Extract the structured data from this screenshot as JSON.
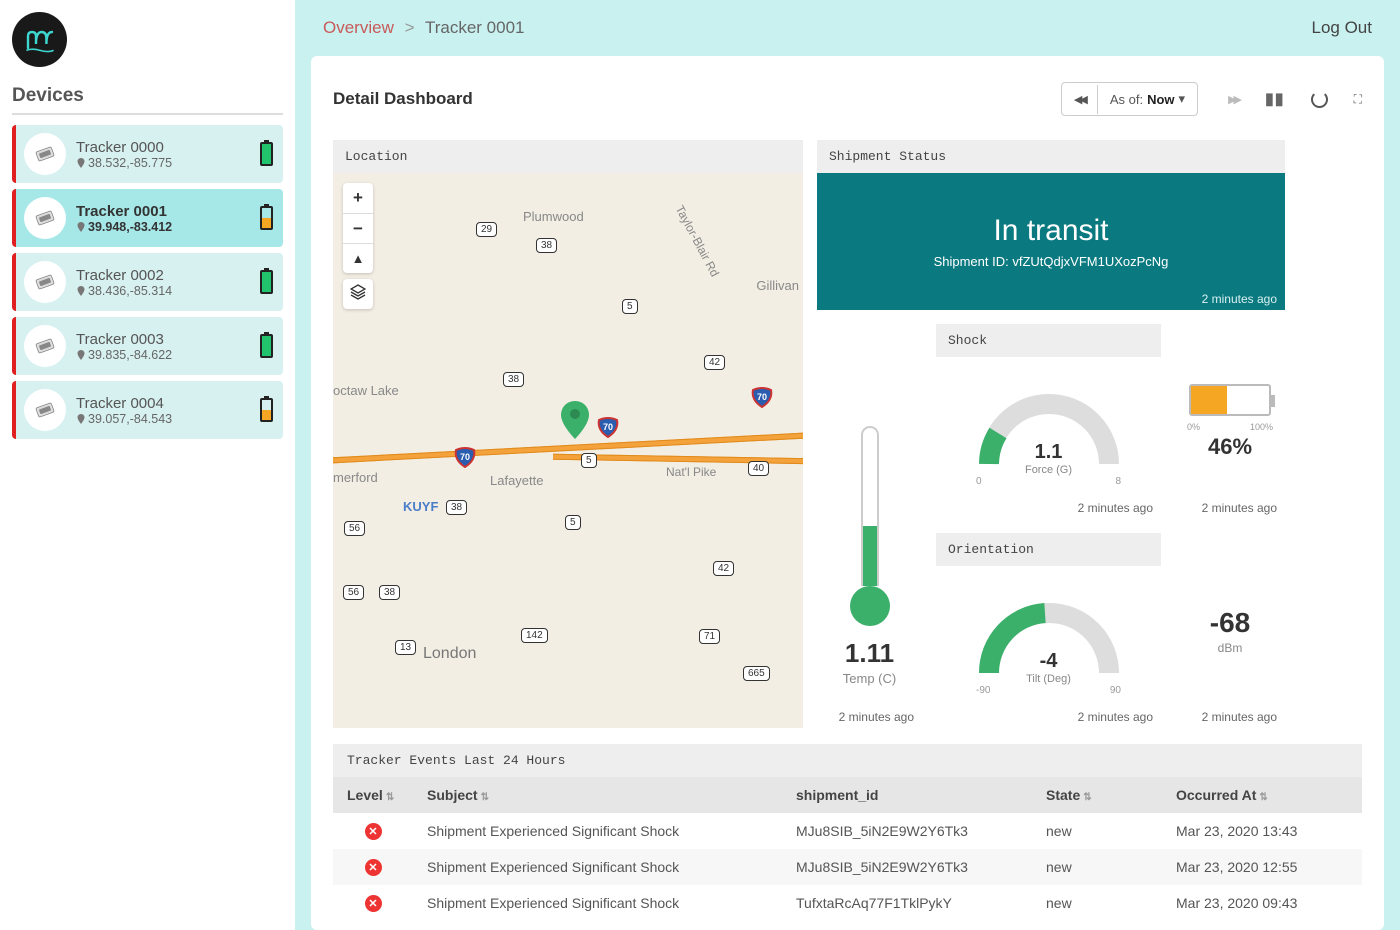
{
  "sidebar": {
    "title": "Devices",
    "items": [
      {
        "name": "Tracker 0000",
        "loc": "38.532,-85.775",
        "battery": "green",
        "active": false
      },
      {
        "name": "Tracker 0001",
        "loc": "39.948,-83.412",
        "battery": "orange",
        "active": true
      },
      {
        "name": "Tracker 0002",
        "loc": "38.436,-85.314",
        "battery": "green",
        "active": false
      },
      {
        "name": "Tracker 0003",
        "loc": "39.835,-84.622",
        "battery": "green",
        "active": false
      },
      {
        "name": "Tracker 0004",
        "loc": "39.057,-84.543",
        "battery": "orange",
        "active": false
      }
    ]
  },
  "topbar": {
    "crumb_overview": "Overview",
    "crumb_sep": ">",
    "crumb_current": "Tracker 0001",
    "logout": "Log Out"
  },
  "dash": {
    "title": "Detail Dashboard",
    "asof_label": "As of:",
    "asof_value": "Now",
    "prev_icon": "◀◀",
    "next_icon": "▶▶",
    "caret": "▾"
  },
  "cards": {
    "location": {
      "header": "Location"
    },
    "status": {
      "header": "Shipment Status",
      "value": "In transit",
      "sub_label": "Shipment ID:",
      "shipment_id": "vfZUtQdjxVFM1UXozPcNg",
      "ts": "2 minutes ago"
    },
    "temp": {
      "value": "1.11",
      "unit": "Temp (C)",
      "ts": "2 minutes ago"
    },
    "shock": {
      "header": "Shock",
      "value": "1.1",
      "unit": "Force (G)",
      "min": "0",
      "max": "8",
      "ts": "2 minutes ago"
    },
    "orient": {
      "header": "Orientation",
      "value": "-4",
      "unit": "Tilt (Deg)",
      "min": "-90",
      "max": "90",
      "ts": "2 minutes ago"
    },
    "batt": {
      "pct": "46%",
      "min": "0%",
      "max": "100%",
      "ts": "2 minutes ago",
      "fill_pct": 46
    },
    "signal": {
      "value": "-68",
      "unit": "dBm",
      "ts": "2 minutes ago"
    }
  },
  "map": {
    "towns": {
      "plumwood": "Plumwood",
      "gillivan": "Gillivan",
      "lafayette": "Lafayette",
      "london": "London",
      "choctaw": "octaw Lake",
      "merford": "merford",
      "kuyf": "KUYF",
      "natl_pike": "Nat'l Pike",
      "taylor_blair": "Taylor-Blair Rd"
    },
    "shields": {
      "r29": "29",
      "r38a": "38",
      "r38b": "38",
      "r38c": "38",
      "r38d": "38",
      "r5a": "5",
      "r5b": "5",
      "r5c": "5",
      "r42a": "42",
      "r42b": "42",
      "r56a": "56",
      "r56b": "56",
      "r40": "40",
      "r71": "71",
      "r142": "142",
      "r13": "13",
      "r665": "665",
      "i70a": "70",
      "i70b": "70",
      "i70c": "70"
    }
  },
  "events": {
    "header": "Tracker Events Last 24 Hours",
    "columns": {
      "level": "Level",
      "subject": "Subject",
      "shipment": "shipment_id",
      "state": "State",
      "occurred": "Occurred At"
    },
    "rows": [
      {
        "subject": "Shipment Experienced Significant Shock",
        "shipment_id": "MJu8SIB_5iN2E9W2Y6Tk3",
        "state": "new",
        "occurred": "Mar 23, 2020 13:43"
      },
      {
        "subject": "Shipment Experienced Significant Shock",
        "shipment_id": "MJu8SIB_5iN2E9W2Y6Tk3",
        "state": "new",
        "occurred": "Mar 23, 2020 12:55"
      },
      {
        "subject": "Shipment Experienced Significant Shock",
        "shipment_id": "TufxtaRcAq77F1TklPykY",
        "state": "new",
        "occurred": "Mar 23, 2020 09:43"
      }
    ]
  },
  "colors": {
    "accent_teal": "#0a7a80",
    "green": "#3bb06a",
    "orange": "#f5a623",
    "red": "#e33"
  }
}
